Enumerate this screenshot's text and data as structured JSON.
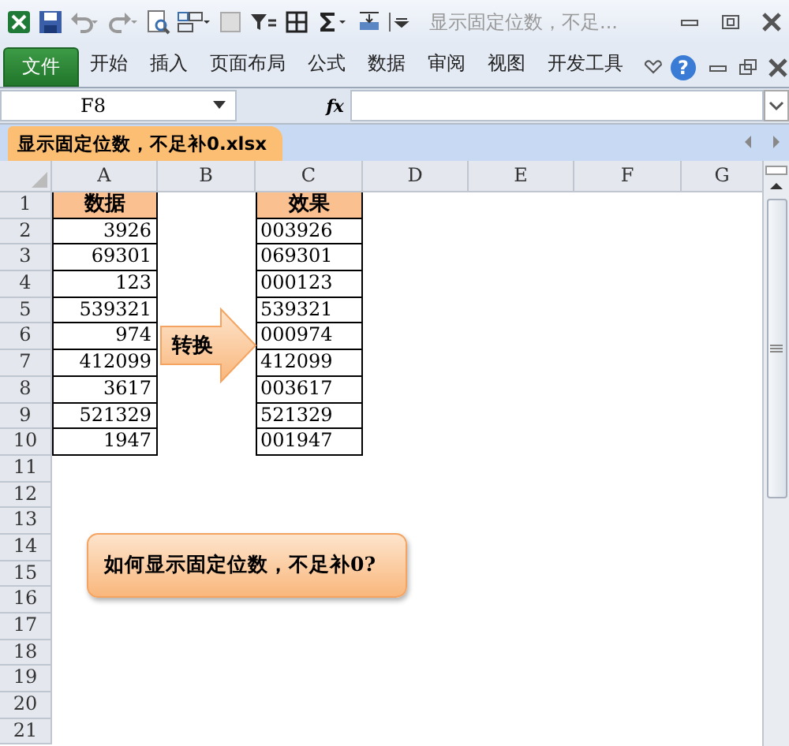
{
  "title_bar": {
    "title": "显示固定位数，不足..."
  },
  "ribbon": {
    "tabs": [
      {
        "label": "文件",
        "kind": "file"
      },
      {
        "label": "开始",
        "kind": "tab"
      },
      {
        "label": "插入",
        "kind": "tab"
      },
      {
        "label": "页面布局",
        "kind": "tab"
      },
      {
        "label": "公式",
        "kind": "tab"
      },
      {
        "label": "数据",
        "kind": "tab"
      },
      {
        "label": "审阅",
        "kind": "tab"
      },
      {
        "label": "视图",
        "kind": "tab"
      },
      {
        "label": "开发工具",
        "kind": "tab"
      }
    ],
    "help": "?"
  },
  "formula_bar": {
    "name_box": "F8",
    "function_label": "fx"
  },
  "workbook_tab": {
    "label": "显示固定位数，不足补0.xlsx"
  },
  "sheet": {
    "columns": [
      "A",
      "B",
      "C",
      "D",
      "E",
      "F",
      "G"
    ],
    "rows": [
      {
        "number": "1",
        "kind": "header",
        "A": "数据",
        "C": "效果"
      },
      {
        "number": "2",
        "kind": "data",
        "A": "3926",
        "C": "003926"
      },
      {
        "number": "3",
        "kind": "data",
        "A": "69301",
        "C": "069301"
      },
      {
        "number": "4",
        "kind": "data",
        "A": "123",
        "C": "000123"
      },
      {
        "number": "5",
        "kind": "data",
        "A": "539321",
        "C": "539321"
      },
      {
        "number": "6",
        "kind": "data",
        "A": "974",
        "C": "000974"
      },
      {
        "number": "7",
        "kind": "data",
        "A": "412099",
        "C": "412099"
      },
      {
        "number": "8",
        "kind": "data",
        "A": "3617",
        "C": "003617"
      },
      {
        "number": "9",
        "kind": "data",
        "A": "521329",
        "C": "521329"
      },
      {
        "number": "10",
        "kind": "data",
        "A": "1947",
        "C": "001947"
      },
      {
        "number": "11"
      },
      {
        "number": "12"
      },
      {
        "number": "13"
      },
      {
        "number": "14"
      },
      {
        "number": "15"
      },
      {
        "number": "16"
      },
      {
        "number": "17"
      },
      {
        "number": "18"
      },
      {
        "number": "19"
      },
      {
        "number": "20"
      },
      {
        "number": "21"
      }
    ]
  },
  "shapes": [
    {
      "kind": "arrow",
      "text": "转换"
    },
    {
      "kind": "callout",
      "text": "如何显示固定位数，不足补0?"
    }
  ]
}
